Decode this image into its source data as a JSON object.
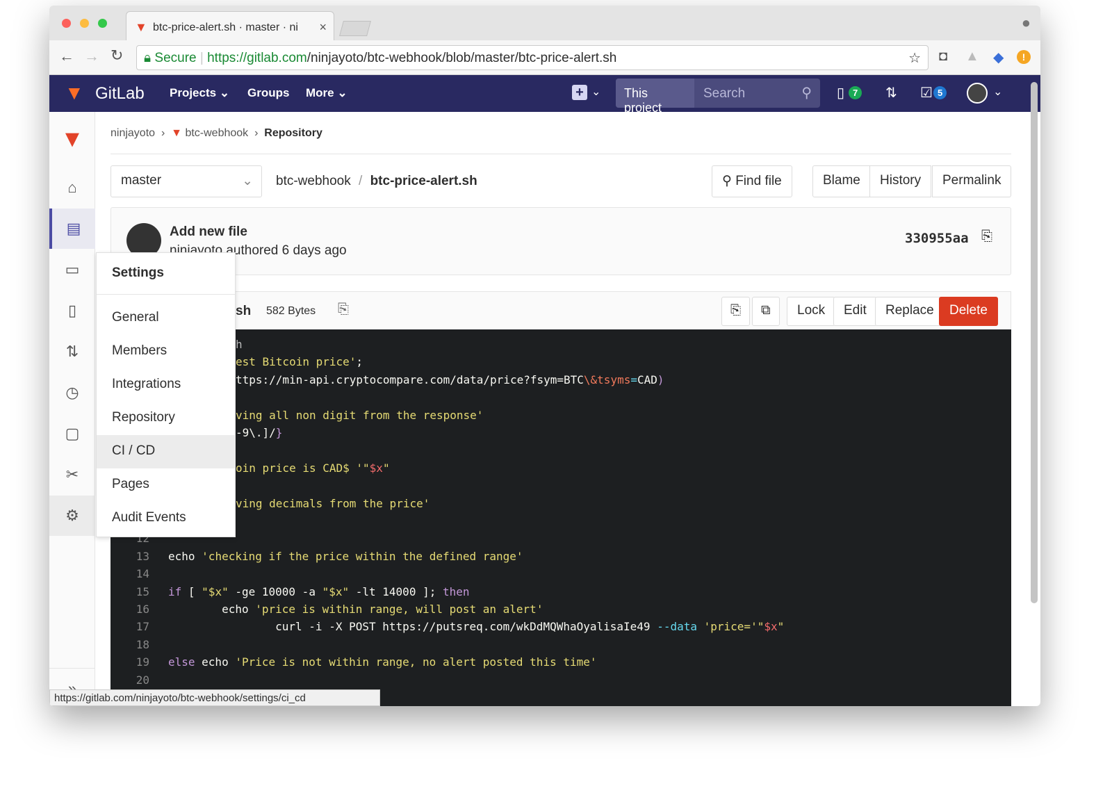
{
  "browser": {
    "tab_title": "btc-price-alert.sh · master · ni",
    "secure_label": "Secure",
    "url_host": "https://gitlab.com",
    "url_path": "/ninjayoto/btc-webhook/blob/master/btc-price-alert.sh"
  },
  "nav": {
    "brand": "GitLab",
    "projects": "Projects",
    "groups": "Groups",
    "more": "More",
    "scope": "This project",
    "search_placeholder": "Search",
    "issues_count": "7",
    "todos_count": "5"
  },
  "breadcrumb": {
    "user": "ninjayoto",
    "project": "btc-webhook",
    "current": "Repository"
  },
  "file_bar": {
    "branch": "master",
    "repo": "btc-webhook",
    "sep": "/",
    "file": "btc-price-alert.sh",
    "find_file": "Find file",
    "blame": "Blame",
    "history": "History",
    "permalink": "Permalink"
  },
  "commit": {
    "title": "Add new file",
    "meta": "ninjayoto authored 6 days ago",
    "sha": "330955aa"
  },
  "blob": {
    "name_fragment": "rt.sh",
    "size": "582 Bytes",
    "lock": "Lock",
    "edit": "Edit",
    "replace": "Replace",
    "delete": "Delete"
  },
  "menu": {
    "title": "Settings",
    "items": [
      "General",
      "Members",
      "Integrations",
      "Repository",
      "CI / CD",
      "Pages",
      "Audit Events"
    ]
  },
  "code_partial": [
    [
      {
        "t": "h",
        "c": "#bbb"
      }
    ],
    [
      {
        "t": "est Bitcoin price'",
        "c": "#e6db74"
      },
      {
        "t": ";",
        "c": "#f8f8f2"
      }
    ],
    [
      {
        "t": "ttps://min-api.cryptocompare.com/data/price?fsym=BTC",
        "c": "#f8f8f2"
      },
      {
        "t": "\\&tsyms",
        "c": "#f0795b"
      },
      {
        "t": "=",
        "c": "#66d9ef"
      },
      {
        "t": "CAD",
        "c": "#f8f8f2"
      },
      {
        "t": ")",
        "c": "#c397d8"
      }
    ],
    [],
    [
      {
        "t": "ving all non digit from the response'",
        "c": "#e6db74"
      }
    ],
    [
      {
        "t": "-9\\.]/",
        "c": "#f8f8f2"
      },
      {
        "t": "}",
        "c": "#c397d8"
      }
    ],
    [],
    [
      {
        "t": "oin price is CAD$ '",
        "c": "#e6db74"
      },
      {
        "t": "\"",
        "c": "#e6db74"
      },
      {
        "t": "$x",
        "c": "#f26b6b"
      },
      {
        "t": "\"",
        "c": "#e6db74"
      }
    ],
    [],
    [
      {
        "t": "ving decimals from the price'",
        "c": "#e6db74"
      }
    ],
    []
  ],
  "code_lines": [
    {
      "n": "12",
      "seg": []
    },
    {
      "n": "13",
      "seg": [
        {
          "t": "echo ",
          "c": "#f8f8f2"
        },
        {
          "t": "'checking if the price within the defined range'",
          "c": "#e6db74"
        }
      ]
    },
    {
      "n": "14",
      "seg": []
    },
    {
      "n": "15",
      "seg": [
        {
          "t": "if",
          "c": "#c397d8"
        },
        {
          "t": " [ ",
          "c": "#f8f8f2"
        },
        {
          "t": "\"$x\"",
          "c": "#e6db74"
        },
        {
          "t": " -ge ",
          "c": "#f8f8f2"
        },
        {
          "t": "10000",
          "c": "#f8f8f2"
        },
        {
          "t": " -a ",
          "c": "#f8f8f2"
        },
        {
          "t": "\"$x\"",
          "c": "#e6db74"
        },
        {
          "t": " -lt ",
          "c": "#f8f8f2"
        },
        {
          "t": "14000",
          "c": "#f8f8f2"
        },
        {
          "t": " ]; ",
          "c": "#f8f8f2"
        },
        {
          "t": "then",
          "c": "#c397d8"
        }
      ]
    },
    {
      "n": "16",
      "seg": [
        {
          "t": "        echo ",
          "c": "#f8f8f2"
        },
        {
          "t": "'price is within range, will post an alert'",
          "c": "#e6db74"
        }
      ]
    },
    {
      "n": "17",
      "seg": [
        {
          "t": "                curl -i -X POST https://putsreq.com/wkDdMQWhaOyalisaIe49 ",
          "c": "#f8f8f2"
        },
        {
          "t": "--data",
          "c": "#66d9ef"
        },
        {
          "t": " 'price='\"",
          "c": "#e6db74"
        },
        {
          "t": "$x",
          "c": "#f26b6b"
        },
        {
          "t": "\"",
          "c": "#e6db74"
        }
      ]
    },
    {
      "n": "18",
      "seg": []
    },
    {
      "n": "19",
      "seg": [
        {
          "t": "else",
          "c": "#c397d8"
        },
        {
          "t": " echo ",
          "c": "#f8f8f2"
        },
        {
          "t": "'Price is not within range, no alert posted this time'",
          "c": "#e6db74"
        }
      ]
    },
    {
      "n": "20",
      "seg": []
    }
  ],
  "status_url": "https://gitlab.com/ninjayoto/btc-webhook/settings/ci_cd"
}
